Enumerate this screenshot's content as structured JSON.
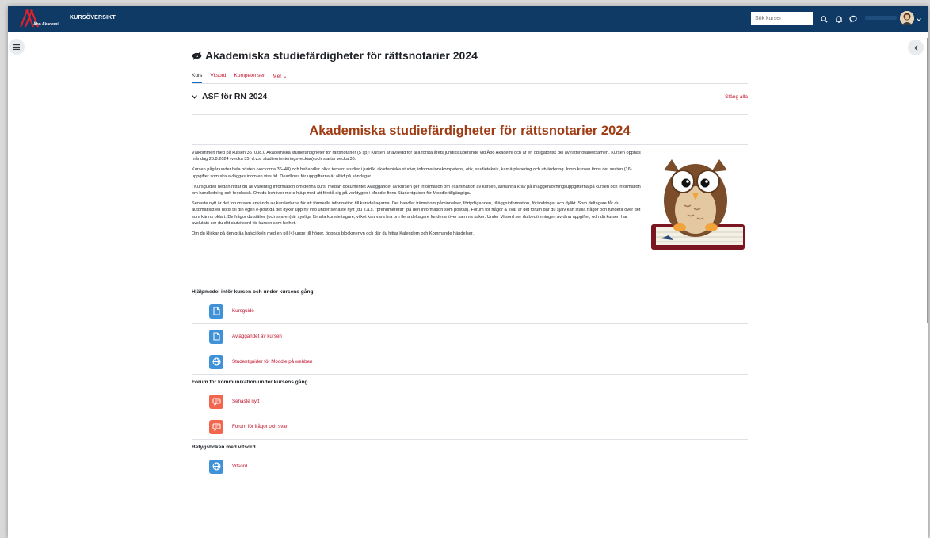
{
  "navbar": {
    "brand": "Åbo Akademi",
    "nav_link": "KURSÖVERSIKT",
    "search_placeholder": "Sök kurser"
  },
  "course": {
    "title": "Akademiska studiefärdigheter för rättsnotarier 2024",
    "tabs": [
      {
        "label": "Kurs",
        "active": true
      },
      {
        "label": "Vitsord",
        "active": false
      },
      {
        "label": "Kompetenser",
        "active": false
      },
      {
        "label": "Mer ⌄",
        "active": false
      }
    ]
  },
  "section": {
    "title": "ASF för RN 2024",
    "collapse_all": "Stäng alla"
  },
  "summary": {
    "heading": "Akademiska studiefärdigheter för rättsnotarier 2024",
    "p1": "Välkommen med på kursen 357008.0 Akademiska studiefärdigheter för rättsnotarier (5 sp)! Kursen är avsedd för alla första årets juridikstuderande vid Åbo Akademi och är en obligatorisk del av rättsnotarieexamen. Kursen öppnas måndag 26.8.2024 (vecka 35, d.v.s. studieorienteringsveckan) och startar vecka 36.",
    "p2": "Kursen pågår under hela hösten (veckorna 36–48) och behandlar olika teman: studier i juridik, akademiska studier, informationskompetens, etik, studieteknik, karriärplanering och utvärdering. Inom kursen finns det sexton (16) uppgifter som ska avläggas inom en viss tid. Deadlines för uppgifterna är alltid på söndagar.",
    "p3": "I Kursguiden nedan hittar du all väsentlig information om denna kurs, medan dokumentet Avläggandet av kursen ger information om examination av kursen, allmänna krav på inläggen/övningsuppgifterna på kursen och information om handledning och feedback. Om du behöver mera hjälp med att förstå dig på verktygen i Moodle finns Studentguider för Moodle tillgängliga.",
    "p4": "Senaste nytt är det forum som används av kursledarna för att förmedla information till kursdeltagarna. Det handlar främst om påminnelser, förtydliganden, tilläggsinformation, förändringar och dylikt. Som deltagare får du automatiskt en notis till din egen e-post då det dyker upp ny info under senaste nytt (du s.a.s. \"prenumererar\" på den information som postas). Forum för frågor & svar är det forum där du själv kan ställa frågor och fundera över det som känns oklart. De frågor du ställer (och svaren) är synliga för alla kursdeltagare, vilket kan vara bra om flera deltagare funderar över samma saker. Under Vitsord ser du bedömningen av dina uppgifter, och då kursen har avslutats ser du ditt slutvitsord för kursen som helhet.",
    "p5": "Om du klickar på den gråa halvcirkeln med en pil (<) uppe till höger, öppnas blockmenyn och där du hittar Kalendern och Kommande händelser."
  },
  "groups": [
    {
      "heading": "Hjälpmedel inför kursen och under kursens gång",
      "items": [
        {
          "label": "Kursguide",
          "icon": "file-icon",
          "color": "blue"
        },
        {
          "label": "Avläggandet av kursen",
          "icon": "file-icon",
          "color": "blue"
        },
        {
          "label": "Studentguider för Moodle på webben",
          "icon": "globe-icon",
          "color": "blue"
        }
      ]
    },
    {
      "heading": "Forum för kommunikation under kursens gång",
      "items": [
        {
          "label": "Senaste nytt",
          "icon": "forum-icon",
          "color": "red"
        },
        {
          "label": "Forum för frågor och svar",
          "icon": "forum-icon",
          "color": "red"
        }
      ]
    },
    {
      "heading": "Betygsboken med vitsord",
      "items": [
        {
          "label": "Vitsord",
          "icon": "globe-icon",
          "color": "blue"
        }
      ]
    }
  ],
  "colors": {
    "navbar": "#0f3a66",
    "link": "#c0132b",
    "heading_accent": "#a03c14",
    "resource_icon": "#3f92d8",
    "forum_icon": "#f2654e"
  }
}
